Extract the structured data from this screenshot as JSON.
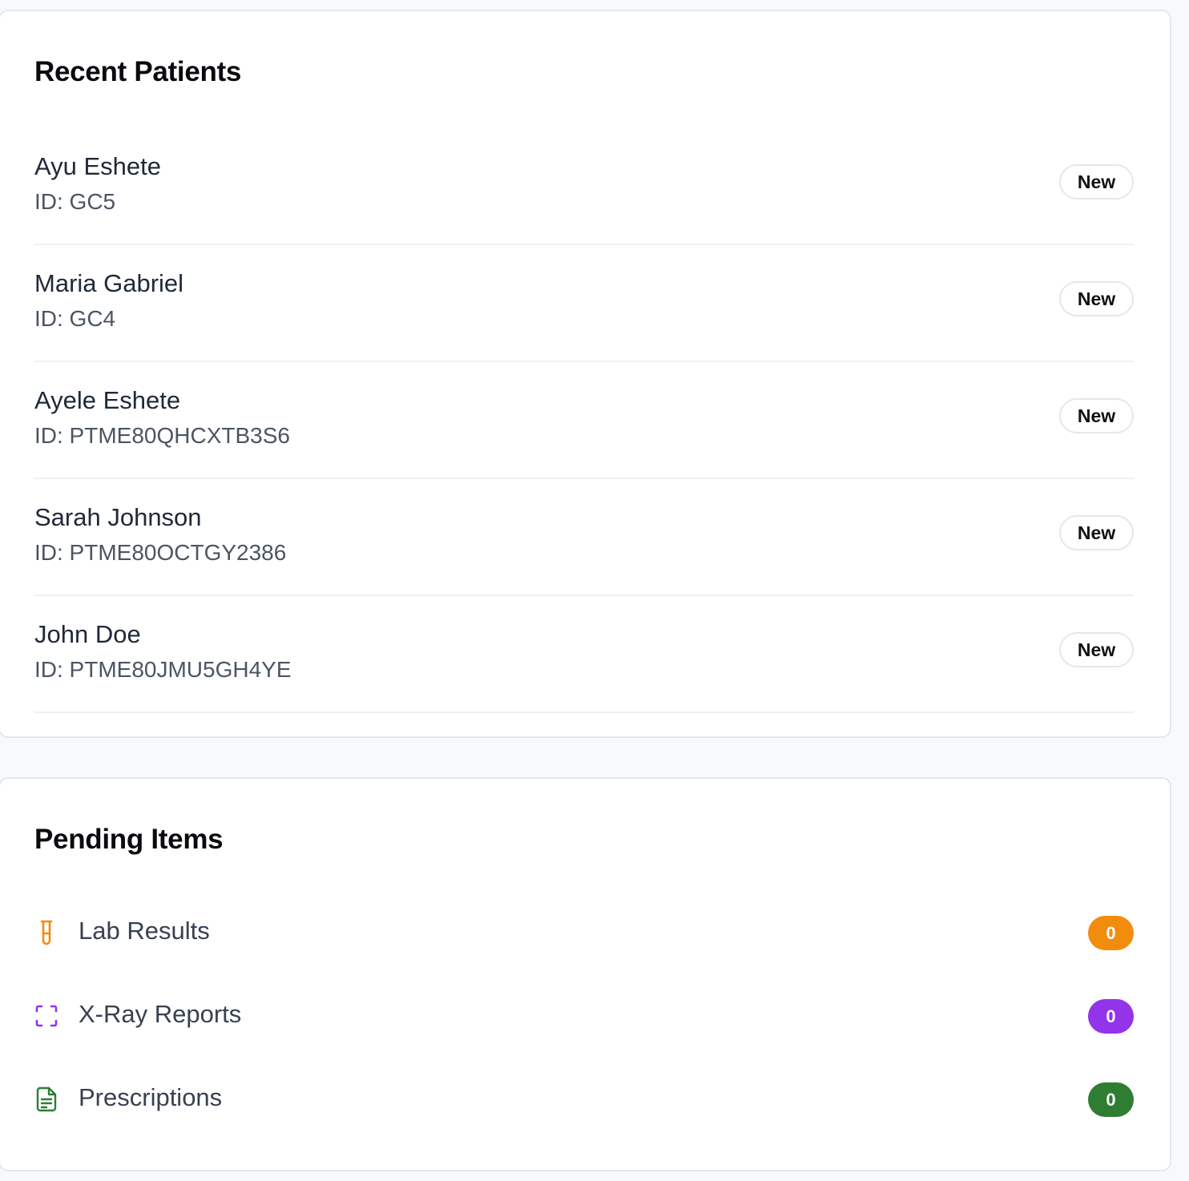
{
  "recent_patients": {
    "title": "Recent Patients",
    "patients": [
      {
        "name": "Ayu Eshete",
        "id": "ID: GC5",
        "badge": "New"
      },
      {
        "name": "Maria Gabriel",
        "id": "ID: GC4",
        "badge": "New"
      },
      {
        "name": "Ayele Eshete",
        "id": "ID: PTME80QHCXTB3S6",
        "badge": "New"
      },
      {
        "name": "Sarah Johnson",
        "id": "ID: PTME80OCTGY2386",
        "badge": "New"
      },
      {
        "name": "John Doe",
        "id": "ID: PTME80JMU5GH4YE",
        "badge": "New"
      }
    ]
  },
  "pending_items": {
    "title": "Pending Items",
    "items": [
      {
        "label": "Lab Results",
        "count": "0",
        "icon": "test-tube-icon",
        "color": "#f28c0f"
      },
      {
        "label": "X-Ray Reports",
        "count": "0",
        "icon": "scan-frame-icon",
        "color": "#9333ea"
      },
      {
        "label": "Prescriptions",
        "count": "0",
        "icon": "document-icon",
        "color": "#2e7d32"
      }
    ]
  }
}
